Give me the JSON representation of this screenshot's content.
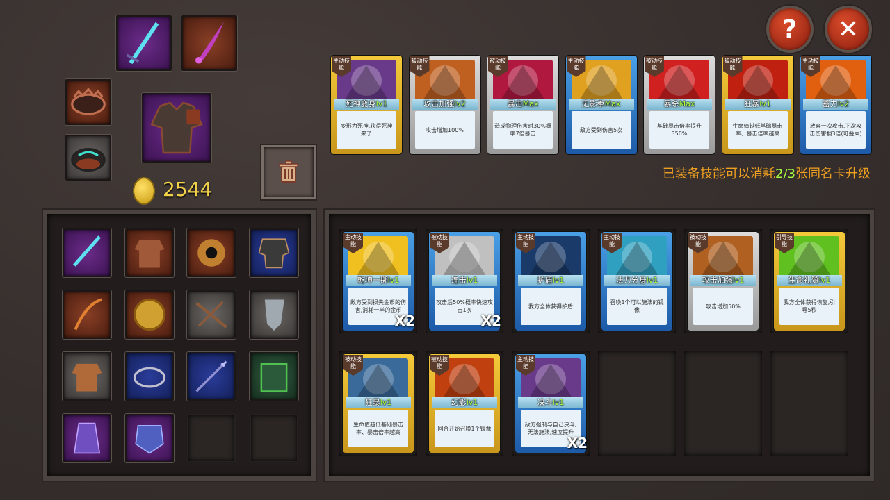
{
  "coins": "2544",
  "upgrade_hint": {
    "prefix": "已装备技能可以消耗",
    "count": "2/3",
    "suffix": "张同名卡升级"
  },
  "buttons": {
    "help": "?",
    "close": "✕"
  },
  "equipped_gear": [
    {
      "name": "blue-sword-icon"
    },
    {
      "name": "purple-dagger-icon"
    },
    {
      "name": "spiked-bracer-icon"
    },
    {
      "name": "leather-armor-icon"
    },
    {
      "name": "rune-ring-icon"
    }
  ],
  "inventory": [
    {
      "name": "blue-sword-icon"
    },
    {
      "name": "cloth-tunic-icon"
    },
    {
      "name": "eye-amulet-icon"
    },
    {
      "name": "iron-armor-icon"
    },
    {
      "name": "fire-bow-icon"
    },
    {
      "name": "gold-shield-icon"
    },
    {
      "name": "crossbow-icon"
    },
    {
      "name": "kite-shield-icon"
    },
    {
      "name": "leather-tunic-icon"
    },
    {
      "name": "silver-ring-icon"
    },
    {
      "name": "spear-icon"
    },
    {
      "name": "spellbook-icon"
    },
    {
      "name": "purple-robe-icon"
    },
    {
      "name": "crystal-armor-icon"
    }
  ],
  "equipped_skills": [
    {
      "type": "主动\n技能",
      "name": "死神变身",
      "lv": "lv1",
      "desc": "变形为死神,获得死神来了",
      "frame": "gold"
    },
    {
      "type": "被动\n技能",
      "name": "攻击加强",
      "lv": "lv2",
      "desc": "攻击增加100%",
      "frame": "silver"
    },
    {
      "type": "被动\n技能",
      "name": "暴击",
      "lv": "Max",
      "desc": "造成物理伤害时30%概率7倍暴击",
      "frame": "silver"
    },
    {
      "type": "主动\n技能",
      "name": "无影拳",
      "lv": "Max",
      "desc": "敌方受到伤害5次",
      "frame": "bluec"
    },
    {
      "type": "被动\n技能",
      "name": "暴杀",
      "lv": "Max",
      "desc": "基础暴击倍率提升350%",
      "frame": "silver"
    },
    {
      "type": "被动\n技能",
      "name": "狂暴",
      "lv": "lv1",
      "desc": "生命值越低基础暴击率、暴击倍率越高",
      "frame": "gold"
    },
    {
      "type": "主动\n技能",
      "name": "蓄力",
      "lv": "lv2",
      "desc": "放弃一次攻击,下次攻击伤害翻3倍(可叠乘)",
      "frame": "bluec"
    }
  ],
  "owned_skills": [
    {
      "type": "主动\n技能",
      "name": "乾坤一掷",
      "lv": "lv1",
      "desc": "敌方受到损失金币的伤害,消耗一半的金币",
      "frame": "bluec",
      "mult": "X2"
    },
    {
      "type": "被动\n技能",
      "name": "连击",
      "lv": "lv1",
      "desc": "攻击后50%概率快速攻击1次",
      "frame": "bluec",
      "mult": "X2"
    },
    {
      "type": "主动\n技能",
      "name": "护盾",
      "lv": "lv1",
      "desc": "我方全体获得护盾",
      "frame": "bluec",
      "mult": ""
    },
    {
      "type": "主动\n技能",
      "name": "法力分身",
      "lv": "lv1",
      "desc": "召唤1个可以施法的镜像",
      "frame": "bluec",
      "mult": ""
    },
    {
      "type": "被动\n技能",
      "name": "攻击加强",
      "lv": "lv1",
      "desc": "攻击增加50%",
      "frame": "silver",
      "mult": ""
    },
    {
      "type": "引导\n技能",
      "name": "生命礼赞",
      "lv": "lv1",
      "desc": "我方全体获得恢复,引导5秒",
      "frame": "gold",
      "mult": ""
    },
    {
      "type": "被动\n技能",
      "name": "狂暴",
      "lv": "lv1",
      "desc": "生命值越低基础暴击率、暴击倍率越高",
      "frame": "gold",
      "mult": ""
    },
    {
      "type": "被动\n技能",
      "name": "幻影",
      "lv": "lv1",
      "desc": "回合开始召唤1个镜像",
      "frame": "gold",
      "mult": ""
    },
    {
      "type": "主动\n技能",
      "name": "决斗",
      "lv": "lv1",
      "desc": "敌方强制与自己决斗,无法施法,速度提升",
      "frame": "bluec",
      "mult": "X2"
    }
  ],
  "colors": {
    "accent": "#f0a020",
    "highlight": "#a8ff40",
    "coin_text": "#f2d24a"
  }
}
